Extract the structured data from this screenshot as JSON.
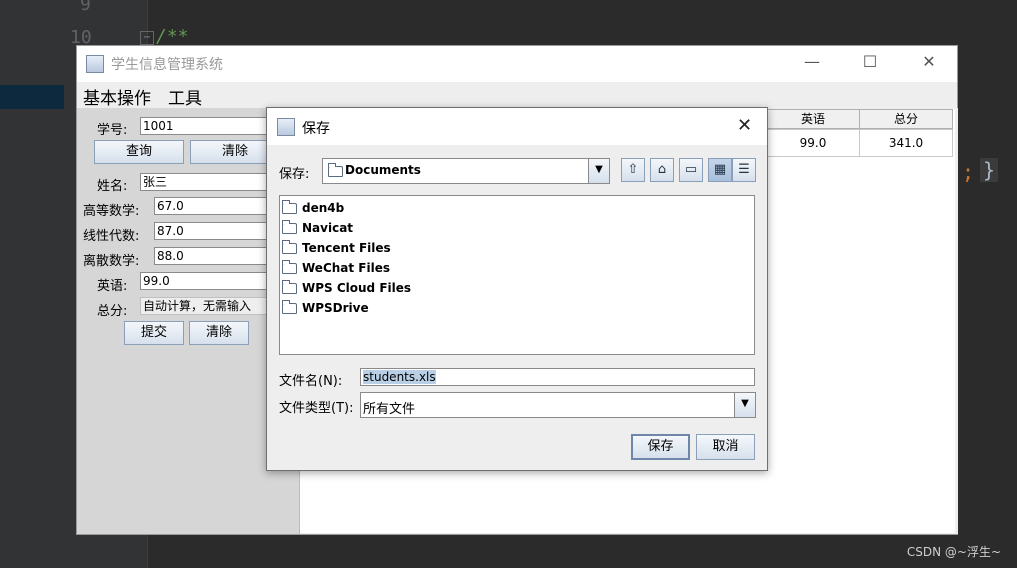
{
  "ide": {
    "line_numbers": [
      "9",
      "10"
    ],
    "code_fragment": "/**",
    "right_fragment_semicolon": ";",
    "right_fragment_brace": "}"
  },
  "watermark": "CSDN @~浮生~",
  "main_window": {
    "title": "学生信息管理系统",
    "controls": {
      "minimize": "—",
      "maximize": "☐",
      "close": "✕"
    },
    "menu": [
      "基本操作",
      "工具"
    ],
    "form": {
      "student_id_label": "学号:",
      "student_id_value": "1001",
      "query_button": "查询",
      "clear_button_top": "清除",
      "name_label": "姓名:",
      "name_value": "张三",
      "math_label": "高等数学:",
      "math_value": "67.0",
      "linear_label": "线性代数:",
      "linear_value": "87.0",
      "discrete_label": "离散数学:",
      "discrete_value": "88.0",
      "english_label": "英语:",
      "english_value": "99.0",
      "total_label": "总分:",
      "total_value": "自动计算，无需输入",
      "submit_button": "提交",
      "clear_button_bottom": "清除"
    },
    "table": {
      "headers": [
        "英语",
        "总分"
      ],
      "rows": [
        [
          "99.0",
          "341.0"
        ]
      ]
    }
  },
  "save_dialog": {
    "title": "保存",
    "close": "✕",
    "save_in_label": "保存:",
    "save_in_value": "Documents",
    "files": [
      "den4b",
      "Navicat",
      "Tencent Files",
      "WeChat Files",
      "WPS Cloud Files",
      "WPSDrive"
    ],
    "filename_label": "文件名(N):",
    "filename_value": "students.xls",
    "filetype_label": "文件类型(T):",
    "filetype_value": "所有文件",
    "save_button": "保存",
    "cancel_button": "取消",
    "toolbar_icons": [
      "up-folder-icon",
      "home-icon",
      "new-folder-icon",
      "list-view-icon",
      "details-view-icon"
    ]
  }
}
